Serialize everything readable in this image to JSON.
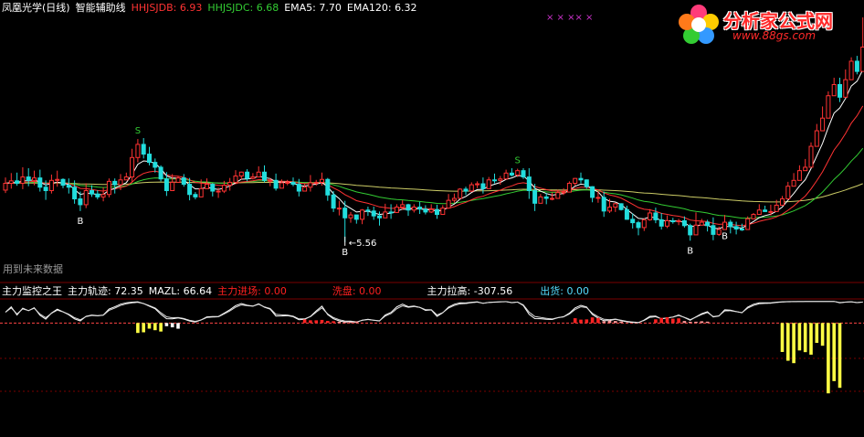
{
  "header": {
    "title": "凤凰光学(日线)",
    "indicator": "智能辅助线",
    "items": [
      {
        "label": "HHJSJDB:",
        "value": "6.93",
        "color": "#ff3333"
      },
      {
        "label": "HHJSJDC:",
        "value": "6.68",
        "color": "#33cc33"
      },
      {
        "label": "EMA5:",
        "value": "7.70",
        "color": "#ffffff"
      },
      {
        "label": "EMA120:",
        "value": "6.32",
        "color": "#ffffff"
      }
    ]
  },
  "future_note": "用到未来数据",
  "sub_header": {
    "items": [
      {
        "label": "主力监控之王",
        "value": "",
        "color": "#ffffff"
      },
      {
        "label": "主力轨迹:",
        "value": "72.35",
        "color": "#ffffff"
      },
      {
        "label": "MAZL:",
        "value": "66.64",
        "color": "#ffffff"
      },
      {
        "label": "主力进场:",
        "value": "0.00",
        "color": "#ff2020"
      },
      {
        "label": "洗盘:",
        "value": "0.00",
        "color": "#ff2020"
      },
      {
        "label": "主力拉高:",
        "value": "-307.56",
        "color": "#ffffff"
      },
      {
        "label": "出货:",
        "value": "0.00",
        "color": "#55ddff"
      }
    ]
  },
  "logo": {
    "brand": "分析家公式网",
    "url": "www.88gs.com"
  },
  "colors": {
    "up": "#ff3333",
    "down": "#22dddd",
    "ema5": "#ffffff",
    "ema_mid": "#ff3333",
    "ema_long": "#33cc33",
    "ema120": "#cccc66",
    "signal": "#33cc33",
    "grid": "#7a0000"
  },
  "chart_data": {
    "type": "candlestick",
    "price_range": [
      4.9,
      10.2
    ],
    "candles": [
      [
        6.63,
        6.77,
        6.89,
        6.57
      ],
      [
        6.77,
        6.82,
        6.98,
        6.66
      ],
      [
        6.82,
        6.77,
        6.99,
        6.72
      ],
      [
        6.77,
        6.9,
        7.1,
        6.65
      ],
      [
        6.9,
        6.83,
        7.08,
        6.71
      ],
      [
        6.83,
        6.88,
        7.03,
        6.73
      ],
      [
        6.88,
        6.69,
        7.05,
        6.6
      ],
      [
        6.69,
        6.62,
        6.83,
        6.43
      ],
      [
        6.62,
        6.83,
        6.95,
        6.56
      ],
      [
        6.83,
        6.85,
        7.03,
        6.7
      ],
      [
        6.85,
        6.73,
        6.87,
        6.67
      ],
      [
        6.73,
        6.69,
        6.87,
        6.56
      ],
      [
        6.69,
        6.45,
        6.83,
        6.35
      ],
      [
        6.45,
        6.33,
        6.6,
        6.2
      ],
      [
        6.33,
        6.62,
        6.77,
        6.26
      ],
      [
        6.62,
        6.55,
        6.73,
        6.49
      ],
      [
        6.55,
        6.49,
        6.63,
        6.44
      ],
      [
        6.49,
        6.54,
        6.69,
        6.4
      ],
      [
        6.54,
        6.81,
        6.87,
        6.48
      ],
      [
        6.81,
        6.74,
        6.87,
        6.56
      ],
      [
        6.74,
        6.84,
        6.96,
        6.63
      ],
      [
        6.84,
        6.9,
        6.99,
        6.84
      ],
      [
        6.9,
        7.3,
        7.48,
        6.8
      ],
      [
        7.3,
        7.57,
        7.68,
        7.2
      ],
      [
        7.57,
        7.37,
        7.7,
        7.28
      ],
      [
        7.37,
        7.2,
        7.52,
        7.14
      ],
      [
        7.2,
        7.1,
        7.28,
        6.99
      ],
      [
        7.1,
        6.86,
        7.14,
        6.81
      ],
      [
        6.86,
        6.62,
        7.0,
        6.51
      ],
      [
        6.62,
        6.79,
        6.96,
        6.67
      ],
      [
        6.79,
        6.88,
        6.91,
        6.79
      ],
      [
        6.88,
        6.75,
        6.96,
        6.7
      ],
      [
        6.75,
        6.54,
        6.88,
        6.42
      ],
      [
        6.54,
        6.49,
        6.59,
        6.44
      ],
      [
        6.49,
        6.66,
        6.85,
        6.58
      ],
      [
        6.66,
        6.75,
        6.87,
        6.74
      ],
      [
        6.75,
        6.61,
        6.77,
        6.5
      ],
      [
        6.61,
        6.61,
        6.68,
        6.47
      ],
      [
        6.61,
        6.73,
        6.82,
        6.57
      ],
      [
        6.73,
        6.79,
        6.88,
        6.62
      ],
      [
        6.79,
        6.92,
        7.04,
        6.8
      ],
      [
        6.92,
        7.0,
        7.01,
        6.85
      ],
      [
        7.0,
        6.87,
        7.06,
        6.81
      ],
      [
        6.87,
        6.9,
        6.98,
        6.85
      ],
      [
        6.9,
        7.0,
        7.12,
        6.93
      ],
      [
        7.0,
        6.83,
        7.14,
        6.79
      ],
      [
        6.83,
        6.83,
        6.88,
        6.71
      ],
      [
        6.83,
        6.67,
        6.97,
        6.62
      ],
      [
        6.67,
        6.78,
        6.85,
        6.68
      ],
      [
        6.78,
        6.79,
        6.84,
        6.73
      ],
      [
        6.79,
        6.75,
        6.89,
        6.71
      ],
      [
        6.75,
        6.61,
        6.86,
        6.5
      ],
      [
        6.61,
        6.69,
        6.77,
        6.62
      ],
      [
        6.69,
        6.78,
        6.94,
        6.6
      ],
      [
        6.78,
        6.79,
        6.84,
        6.72
      ],
      [
        6.79,
        6.85,
        6.99,
        6.72
      ],
      [
        6.85,
        6.53,
        6.88,
        6.41
      ],
      [
        6.53,
        6.26,
        6.61,
        6.18
      ],
      [
        6.26,
        6.26,
        6.41,
        6.11
      ],
      [
        6.26,
        6.06,
        6.41,
        5.56
      ],
      [
        6.06,
        6.12,
        6.18,
        5.96
      ],
      [
        6.12,
        6.03,
        6.12,
        5.94
      ],
      [
        6.03,
        6.22,
        6.24,
        5.93
      ],
      [
        6.22,
        6.2,
        6.29,
        6.1
      ],
      [
        6.2,
        6.1,
        6.29,
        6.02
      ],
      [
        6.1,
        6.06,
        6.19,
        5.9
      ],
      [
        6.06,
        6.18,
        6.35,
        6.1
      ],
      [
        6.18,
        6.17,
        6.34,
        6.04
      ],
      [
        6.17,
        6.28,
        6.34,
        6.16
      ],
      [
        6.28,
        6.33,
        6.42,
        6.22
      ],
      [
        6.33,
        6.22,
        6.35,
        6.1
      ],
      [
        6.22,
        6.28,
        6.34,
        6.17
      ],
      [
        6.28,
        6.24,
        6.39,
        6.14
      ],
      [
        6.24,
        6.18,
        6.32,
        6.13
      ],
      [
        6.18,
        6.23,
        6.34,
        6.16
      ],
      [
        6.23,
        6.13,
        6.33,
        6.04
      ],
      [
        6.13,
        6.26,
        6.32,
        6.13
      ],
      [
        6.26,
        6.42,
        6.55,
        6.32
      ],
      [
        6.42,
        6.46,
        6.56,
        6.37
      ],
      [
        6.46,
        6.65,
        6.67,
        6.54
      ],
      [
        6.65,
        6.61,
        6.7,
        6.53
      ],
      [
        6.61,
        6.74,
        6.79,
        6.59
      ],
      [
        6.74,
        6.76,
        6.81,
        6.67
      ],
      [
        6.76,
        6.66,
        6.89,
        6.56
      ],
      [
        6.66,
        6.84,
        6.9,
        6.74
      ],
      [
        6.84,
        6.83,
        6.97,
        6.77
      ],
      [
        6.83,
        6.86,
        6.92,
        6.74
      ],
      [
        6.86,
        6.98,
        7.05,
        6.87
      ],
      [
        6.98,
        6.94,
        7.08,
        6.91
      ],
      [
        6.94,
        7.03,
        7.07,
        6.9
      ],
      [
        7.03,
        6.9,
        7.08,
        6.86
      ],
      [
        6.9,
        6.62,
        7.08,
        6.45
      ],
      [
        6.62,
        6.36,
        6.76,
        6.2
      ],
      [
        6.36,
        6.49,
        6.55,
        6.38
      ],
      [
        6.49,
        6.46,
        6.57,
        6.34
      ],
      [
        6.46,
        6.46,
        6.58,
        6.42
      ],
      [
        6.46,
        6.58,
        6.64,
        6.46
      ],
      [
        6.58,
        6.59,
        6.67,
        6.53
      ],
      [
        6.59,
        6.77,
        6.81,
        6.73
      ],
      [
        6.77,
        6.87,
        6.88,
        6.72
      ],
      [
        6.87,
        6.84,
        6.99,
        6.77
      ],
      [
        6.84,
        6.7,
        6.85,
        6.66
      ],
      [
        6.7,
        6.48,
        6.71,
        6.38
      ],
      [
        6.48,
        6.48,
        6.61,
        6.37
      ],
      [
        6.48,
        6.2,
        6.6,
        6.08
      ],
      [
        6.2,
        6.28,
        6.45,
        6.16
      ],
      [
        6.28,
        6.35,
        6.37,
        6.18
      ],
      [
        6.35,
        6.23,
        6.36,
        6.21
      ],
      [
        6.23,
        6.03,
        6.31,
        6.02
      ],
      [
        6.03,
        5.96,
        6.15,
        5.84
      ],
      [
        5.96,
        5.86,
        6.0,
        5.7
      ],
      [
        5.86,
        6.02,
        6.05,
        5.79
      ],
      [
        6.02,
        6.16,
        6.24,
        6.0
      ],
      [
        6.16,
        6.02,
        6.27,
        5.95
      ],
      [
        6.02,
        5.89,
        6.16,
        5.82
      ],
      [
        5.89,
        6.0,
        6.11,
        5.85
      ],
      [
        6.0,
        5.98,
        6.06,
        5.94
      ],
      [
        5.98,
        6.0,
        6.04,
        5.91
      ],
      [
        6.0,
        5.9,
        6.09,
        5.86
      ],
      [
        5.9,
        5.71,
        5.94,
        5.59
      ],
      [
        5.71,
        5.91,
        6.17,
        5.84
      ],
      [
        5.91,
        5.97,
        6.04,
        5.94
      ],
      [
        5.97,
        5.9,
        6.02,
        5.78
      ],
      [
        5.9,
        5.72,
        6.07,
        5.6
      ],
      [
        5.72,
        5.82,
        5.88,
        5.69
      ],
      [
        5.82,
        5.97,
        6.12,
        5.89
      ],
      [
        5.97,
        5.88,
        6.02,
        5.74
      ],
      [
        5.88,
        5.83,
        5.98,
        5.72
      ],
      [
        5.83,
        5.82,
        5.94,
        5.79
      ],
      [
        5.82,
        6.04,
        6.09,
        5.97
      ],
      [
        6.04,
        6.13,
        6.16,
        6.03
      ],
      [
        6.13,
        6.22,
        6.34,
        6.16
      ],
      [
        6.22,
        6.19,
        6.31,
        6.18
      ],
      [
        6.19,
        6.19,
        6.33,
        6.11
      ],
      [
        6.19,
        6.32,
        6.43,
        6.19
      ],
      [
        6.32,
        6.45,
        6.51,
        6.37
      ],
      [
        6.45,
        6.71,
        6.8,
        6.61
      ],
      [
        6.71,
        6.83,
        6.98,
        6.77
      ],
      [
        6.83,
        7.03,
        7.14,
        6.91
      ],
      [
        7.03,
        7.1,
        7.27,
        7.04
      ],
      [
        7.1,
        7.53,
        7.61,
        7.4
      ],
      [
        7.53,
        7.85,
        7.99,
        7.75
      ],
      [
        7.85,
        8.11,
        8.35,
        8.07
      ],
      [
        8.11,
        8.57,
        8.66,
        8.41
      ],
      [
        8.57,
        8.8,
        8.94,
        8.72
      ],
      [
        8.8,
        8.54,
        8.94,
        8.44
      ],
      [
        8.54,
        8.9,
        9.11,
        8.76
      ],
      [
        8.9,
        9.28,
        9.36,
        9.14
      ],
      [
        9.28,
        9.07,
        9.39,
        9.01
      ],
      [
        9.07,
        9.57,
        10.18,
        9.45
      ]
    ],
    "ema5_last": 7.7,
    "ema120_last": 6.32,
    "hhjsjdb_last": 6.93,
    "hhjsjdc_last": 6.68,
    "signals": [
      {
        "index": 13,
        "type": "B"
      },
      {
        "index": 23,
        "type": "S"
      },
      {
        "index": 59,
        "type": "B"
      },
      {
        "index": 89,
        "type": "S"
      },
      {
        "index": 119,
        "type": "B"
      },
      {
        "index": 125,
        "type": "B"
      }
    ],
    "low_annotation": {
      "index": 59,
      "label": "5.56"
    },
    "top_markers": "×  ×  ××  ×",
    "oscillator": {
      "range": [
        -520,
        120
      ],
      "trajectory_last": 72.35,
      "mazl_last": 66.64,
      "lift_last": -307.56
    }
  }
}
